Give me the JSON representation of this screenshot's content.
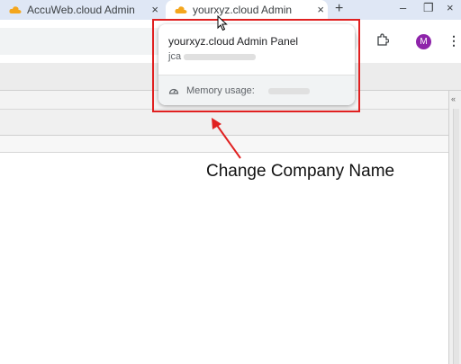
{
  "tabs": [
    {
      "title": "AccuWeb.cloud Admin",
      "active": false
    },
    {
      "title": "yourxyz.cloud Admin",
      "active": true
    }
  ],
  "tab_close": "×",
  "new_tab": "+",
  "window_controls": {
    "minimize": "–",
    "restore": "❐",
    "close": "×"
  },
  "avatar_letter": "M",
  "menu_glyph": "⋮",
  "hover_card": {
    "title": "yourxyz.cloud Admin Panel",
    "domain": "jca",
    "memory_label": "Memory usage:"
  },
  "annotation": {
    "text": "Change Company Name",
    "color": "#e02020"
  },
  "right_panel_chevron": "«",
  "icons": {
    "favicon": "cloud-icon",
    "extensions": "puzzle-icon",
    "memory": "gauge-icon",
    "cursor": "mouse-pointer-icon"
  }
}
